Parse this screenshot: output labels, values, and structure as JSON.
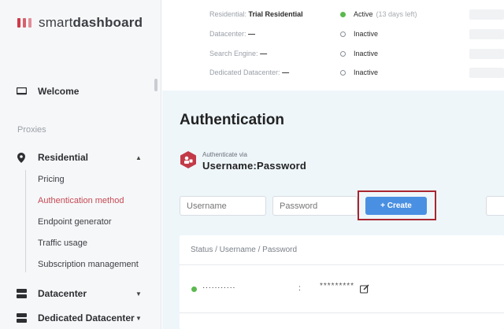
{
  "brand": {
    "name_light": "smart",
    "name_bold": "dashboard",
    "color": "#cf3b4b"
  },
  "sidebar": {
    "welcome": "Welcome",
    "section": "Proxies",
    "residential": "Residential",
    "sub_items": [
      "Pricing",
      "Authentication method",
      "Endpoint generator",
      "Traffic usage",
      "Subscription management"
    ],
    "active_sub": "Authentication method",
    "datacenter": "Datacenter",
    "dedicated_datacenter": "Dedicated Datacenter"
  },
  "plans": [
    {
      "label": "Residential:",
      "value": "Trial Residential",
      "status": "Active",
      "extra": "(13 days left)",
      "active": true
    },
    {
      "label": "Datacenter:",
      "value": "—",
      "status": "Inactive",
      "extra": "",
      "active": false
    },
    {
      "label": "Search Engine:",
      "value": "—",
      "status": "Inactive",
      "extra": "",
      "active": false
    },
    {
      "label": "Dedicated Datacenter:",
      "value": "—",
      "status": "Inactive",
      "extra": "",
      "active": false
    }
  ],
  "auth": {
    "title": "Authentication",
    "via_label": "Authenticate via",
    "method": "Username:Password",
    "username_placeholder": "Username",
    "password_placeholder": "Password",
    "create_label": "+ Create"
  },
  "table": {
    "header": "Status / Username / Password",
    "rows": [
      {
        "username": "···········",
        "separator": ":",
        "password": "*********",
        "status_color": "#5bb94f"
      }
    ]
  },
  "colors": {
    "accent": "#4a90e2",
    "active_nav": "#c54a56",
    "highlight": "#a82630",
    "panel_bg": "#eef6fa"
  }
}
